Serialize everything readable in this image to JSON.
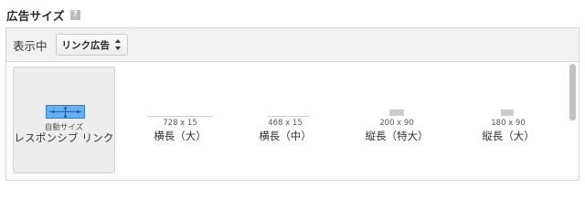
{
  "header": {
    "title": "広告サイズ",
    "help_icon": "?"
  },
  "toolbar": {
    "label": "表示中",
    "select_value": "リンク広告"
  },
  "options": [
    {
      "size": "自動サイズ",
      "label": "レスポンシブ リンク",
      "selected": true,
      "icon": "responsive-ad-icon"
    },
    {
      "size": "728 x 15",
      "label": "横長（大）"
    },
    {
      "size": "468 x 15",
      "label": "横長（中）"
    },
    {
      "size": "200 x 90",
      "label": "縦長（特大）"
    },
    {
      "size": "180 x 90",
      "label": "縦長（大）"
    }
  ],
  "colors": {
    "responsive_icon_fill": "#63b1f2",
    "responsive_icon_border": "#2f7fc8",
    "selected_bg": "#ededed",
    "size_preview": "#cccccc"
  }
}
